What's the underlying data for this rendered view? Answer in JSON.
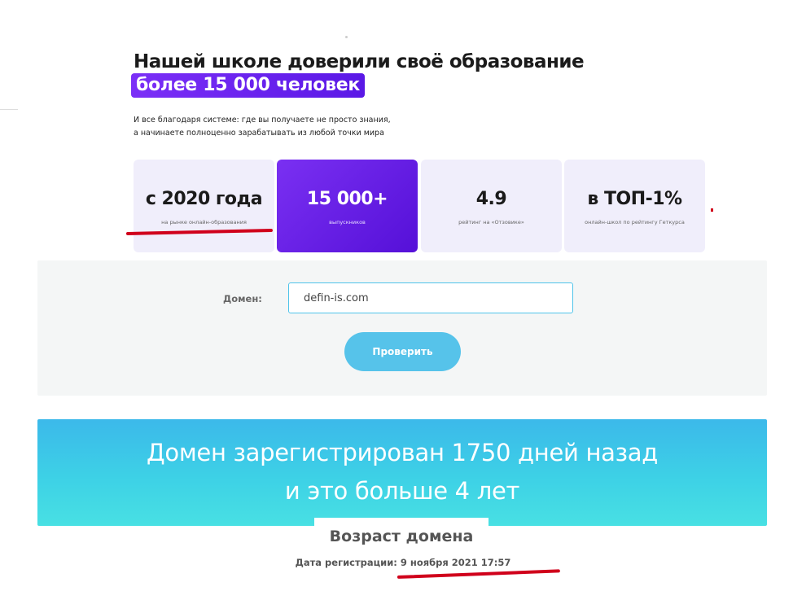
{
  "hero": {
    "title": "Нашей школе доверили своё образование",
    "highlight": "более 15 000 человек",
    "subtitle_line1": "И все благодаря системе: где вы получаете не просто знания,",
    "subtitle_line2": "а начинаете полноценно зарабатывать из любой точки мира"
  },
  "stats": [
    {
      "value": "с 2020 года",
      "caption": "на рынке онлайн-образования"
    },
    {
      "value": "15 000+",
      "caption": "выпускников"
    },
    {
      "value": "4.9",
      "caption": "рейтинг на «Отзовике»"
    },
    {
      "value": "в ТОП-1%",
      "caption": "онлайн-школ по рейтингу Геткурса"
    }
  ],
  "form": {
    "domain_label": "Домен:",
    "domain_value": "defin-is.com",
    "check_button": "Проверить"
  },
  "result": {
    "line1": "Домен зарегистрирован 1750 дней назад",
    "line2": "и это больше 4 лет",
    "age_title": "Возраст домена",
    "reg_date": "Дата регистрации: 9 ноября 2021 17:57"
  },
  "colors": {
    "accent_purple": "#6a22ee",
    "button_blue": "#56c3ea",
    "banner_cyan": "#3dd1e6",
    "annotation_red": "#d0001b"
  }
}
